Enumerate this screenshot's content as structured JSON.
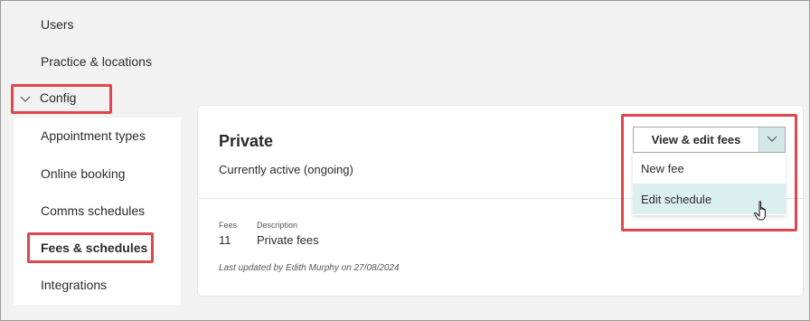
{
  "sidebar": {
    "items": [
      {
        "label": "Users"
      },
      {
        "label": "Practice & locations"
      },
      {
        "label": "Config"
      },
      {
        "label": "Appointment types"
      },
      {
        "label": "Online booking"
      },
      {
        "label": "Comms schedules"
      },
      {
        "label": "Fees & schedules"
      },
      {
        "label": "Integrations"
      }
    ]
  },
  "card": {
    "title": "Private",
    "status": "Currently active (ongoing)",
    "fees_label": "Fees",
    "fees_value": "11",
    "description_label": "Description",
    "description_value": "Private fees",
    "last_updated": "Last updated by Edith Murphy on 27/08/2024"
  },
  "dropdown": {
    "button_label": "View & edit fees",
    "options": [
      {
        "label": "New fee"
      },
      {
        "label": "Edit schedule"
      }
    ]
  },
  "colors": {
    "highlight": "#e0474c",
    "menu_hover": "#dbeef0",
    "caret_bg": "#d4e8ea"
  },
  "icons": [
    "chevron-down-icon",
    "hand-pointer-cursor-icon"
  ]
}
